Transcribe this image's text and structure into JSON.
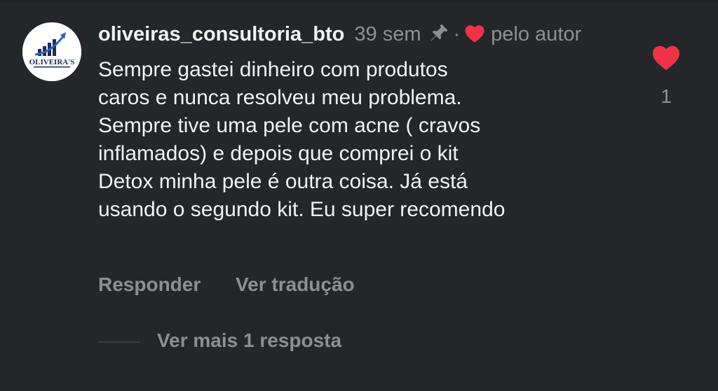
{
  "comment": {
    "avatar_logo_text": "OLIVEIRA'S",
    "username": "oliveiras_consultoria_bto",
    "time": "39 sem",
    "separator": "·",
    "author_label": "pelo autor",
    "text": "Sempre gastei dinheiro com produtos\ncaros e nunca resolveu meu problema.\nSempre tive uma pele com acne ( cravos\ninflamados) e depois que comprei o kit\nDetox minha pele é outra coisa. Já está\nusando o segundo kit. Eu super recomendo",
    "like_count": "1"
  },
  "actions": {
    "reply_label": "Responder",
    "translate_label": "Ver tradução"
  },
  "replies": {
    "more_label": "Ver mais 1 resposta"
  },
  "colors": {
    "background": "#25262a",
    "heart": "#ef3347",
    "primary_text": "#f2f2f3",
    "secondary_text": "#8e8f93",
    "logo_navy": "#1c2a5c"
  },
  "icons": {
    "pin": "pin-icon",
    "author_heart": "heart-icon",
    "like": "heart-like-icon"
  }
}
